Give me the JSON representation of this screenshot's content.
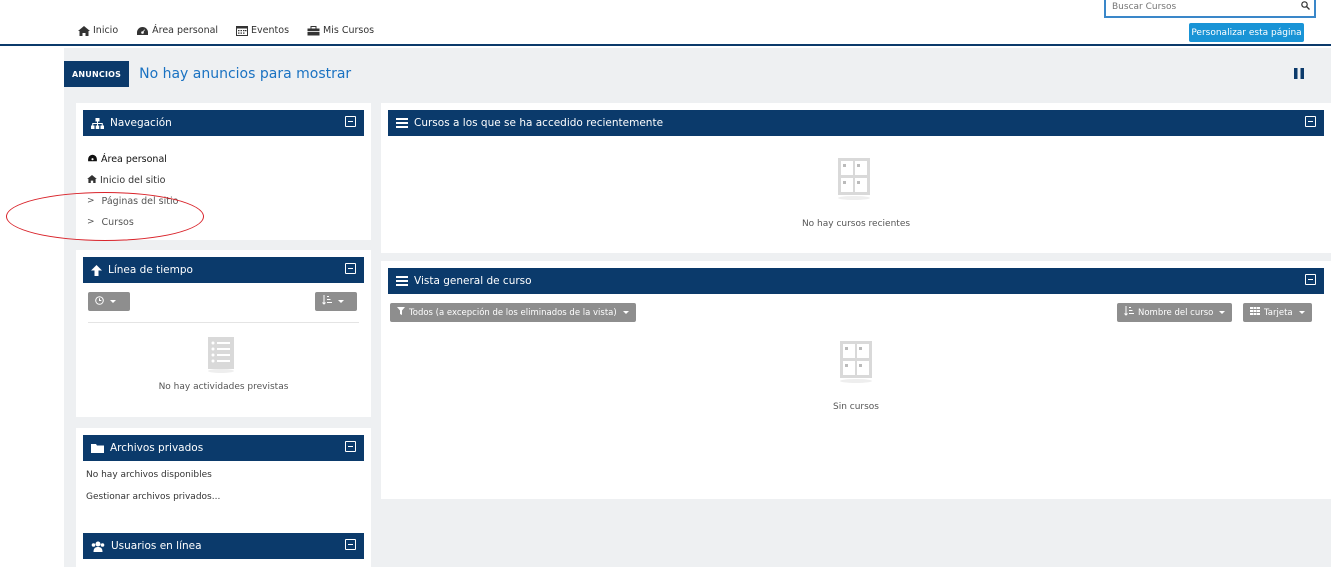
{
  "topnav": {
    "items": [
      {
        "label": "Inicio",
        "icon": "home-icon"
      },
      {
        "label": "Área personal",
        "icon": "dashboard-icon"
      },
      {
        "label": "Eventos",
        "icon": "calendar-icon"
      },
      {
        "label": "Mis Cursos",
        "icon": "briefcase-icon"
      }
    ],
    "search_placeholder": "Buscar Cursos",
    "customize_label": "Personalizar esta página"
  },
  "announcements": {
    "tag": "ANUNCIOS",
    "text": "No hay anuncios para mostrar"
  },
  "navigation": {
    "title": "Navegación",
    "items": [
      {
        "label": "Área personal"
      },
      {
        "label": "Inicio del sitio"
      },
      {
        "label": "Páginas del sitio"
      },
      {
        "label": "Cursos"
      }
    ]
  },
  "timeline": {
    "title": "Línea de tiempo",
    "empty": "No hay actividades previstas"
  },
  "private_files": {
    "title": "Archivos privados",
    "empty": "No hay archivos disponibles",
    "manage": "Gestionar archivos privados..."
  },
  "online_users": {
    "title": "Usuarios en línea"
  },
  "recent_courses": {
    "title": "Cursos a los que se ha accedido recientemente",
    "empty": "No hay cursos recientes"
  },
  "course_overview": {
    "title": "Vista general de curso",
    "filter_label": "Todos (a excepción de los eliminados de la vista)",
    "sort_label": "Nombre del curso",
    "view_label": "Tarjeta",
    "empty": "Sin cursos"
  },
  "colors": {
    "header_navy": "#0b3a6b",
    "accent_blue": "#1994d6",
    "highlight_red": "#d9232a"
  }
}
